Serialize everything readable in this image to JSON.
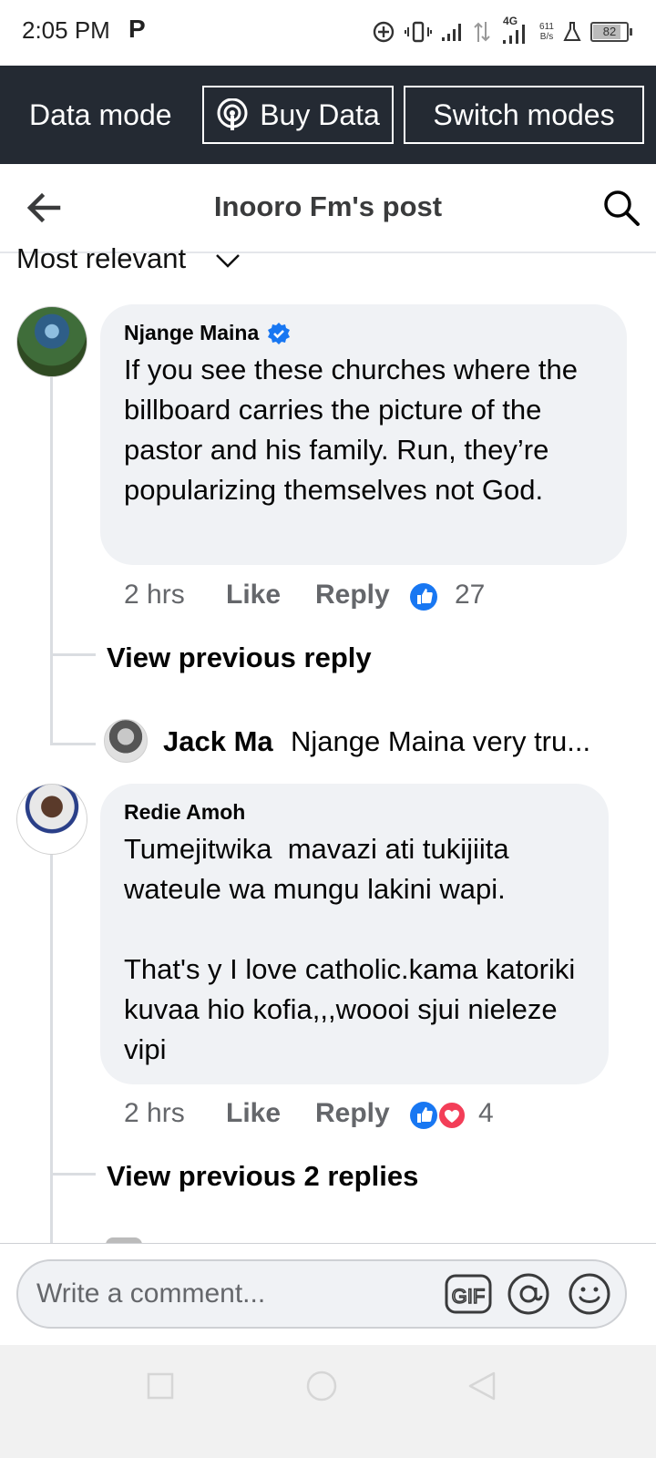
{
  "status_bar": {
    "time": "2:05 PM",
    "app_letter": "P",
    "network_type": "4G",
    "speed_value": "611",
    "speed_unit": "B/s",
    "battery": "82",
    "battery_level_percent": 82
  },
  "data_bar": {
    "mode_label": "Data mode",
    "buy_data_label": "Buy Data",
    "switch_modes_label": "Switch modes"
  },
  "header": {
    "title": "Inooro Fm's post"
  },
  "sort": {
    "label": "Most relevant"
  },
  "comments": [
    {
      "author": "Njange Maina",
      "verified": true,
      "text": "If you see these churches where the billboard carries the picture of the pastor and his family. Run, they’re popularizing themselves not God.",
      "time": "2 hrs",
      "like_label": "Like",
      "reply_label": "Reply",
      "reaction_count": "27",
      "reactions": [
        "like-icon"
      ],
      "view_previous": "View previous reply",
      "reply_preview": {
        "author": "Jack Ma",
        "text": "Njange Maina very tru..."
      }
    },
    {
      "author": "Redie Amoh",
      "verified": false,
      "text": "Tumejitwika  mavazi ati tukijiita wateule wa mungu lakini wapi.\n\nThat's y I love catholic.kama katoriki kuvaa hio kofia,,,woooi sjui nieleze vipi",
      "time": "2 hrs",
      "like_label": "Like",
      "reply_label": "Reply",
      "reaction_count": "4",
      "reactions": [
        "like-icon",
        "love-icon"
      ],
      "view_previous": "View previous 2 replies"
    }
  ],
  "composer": {
    "placeholder": "Write a comment..."
  },
  "colors": {
    "data_bar_bg": "#242a33",
    "bubble_bg": "#f0f2f5",
    "facebook_blue": "#1877f2",
    "love_red": "#f33e58",
    "muted_text": "#65676b"
  }
}
